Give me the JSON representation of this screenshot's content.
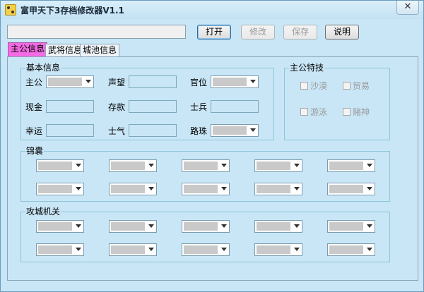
{
  "window": {
    "title": "富甲天下3存档修改器V1.1",
    "close_glyph": "✕"
  },
  "toolbar": {
    "file_path": "",
    "open_label": "打开",
    "modify_label": "修改",
    "save_label": "保存",
    "help_label": "说明"
  },
  "tabs": [
    "主公信息",
    "武将信息",
    "城池信息"
  ],
  "basic": {
    "title": "基本信息",
    "lord": "主公",
    "prestige": "声望",
    "office": "官位",
    "cash": "现金",
    "deposit": "存款",
    "soldiers": "士兵",
    "luck": "幸运",
    "morale": "士气",
    "road_bead": "路珠"
  },
  "skills": {
    "title": "主公特技",
    "items": [
      "沙漠",
      "贸易",
      "游泳",
      "赌神"
    ]
  },
  "pouch": {
    "title": "锦囊"
  },
  "siege": {
    "title": "攻城机关"
  },
  "icons": {
    "app": "dice-icon",
    "dropdown": "chevron-down-icon",
    "close": "close-icon"
  },
  "colors": {
    "background": "#c9e6f6",
    "selected_tab": "#f56be4",
    "group_border": "#8cc4d8"
  }
}
